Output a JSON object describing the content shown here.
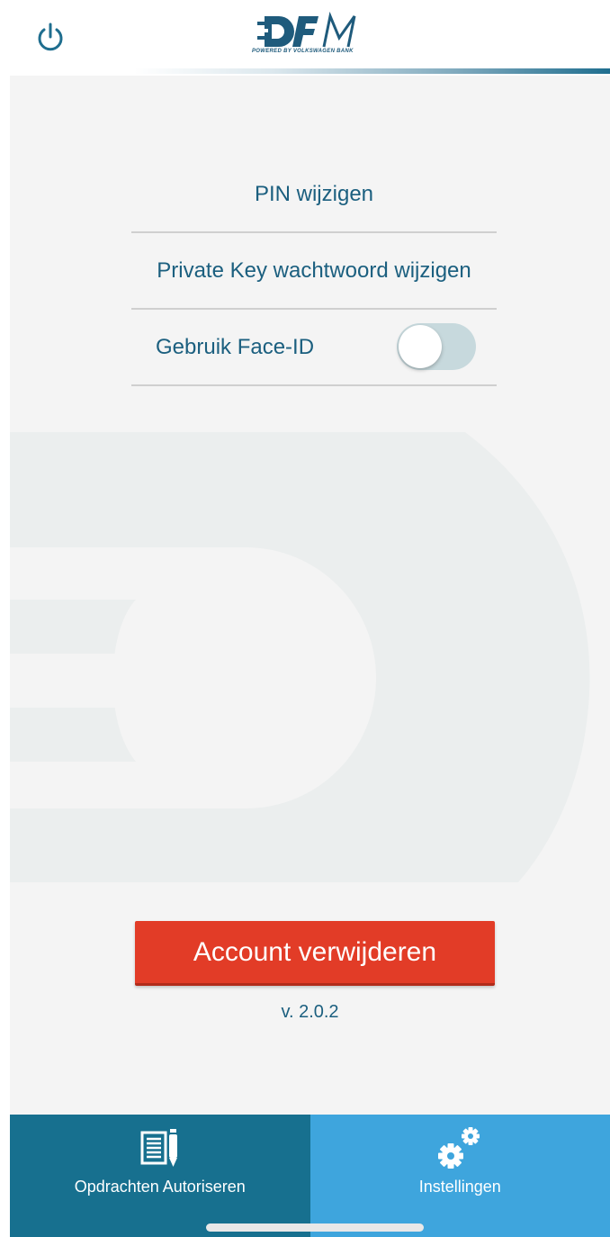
{
  "header": {
    "power_icon": "power-icon",
    "logo_text": "DFM",
    "logo_tagline": "POWERED BY VOLKSWAGEN BANK"
  },
  "settings": {
    "change_pin": "PIN wijzigen",
    "change_private_key_password": "Private Key wachtwoord wijzigen",
    "face_id": {
      "label": "Gebruik Face-ID",
      "enabled": false
    }
  },
  "actions": {
    "delete_account": "Account verwijderen"
  },
  "version": "v. 2.0.2",
  "tabbar": {
    "tabs": [
      {
        "label": "Opdrachten Autoriseren",
        "icon": "document-pen-icon",
        "active": false
      },
      {
        "label": "Instellingen",
        "icon": "gears-icon",
        "active": true
      }
    ]
  },
  "colors": {
    "primary_text": "#1b5f7f",
    "brand_dark": "#1f5b7c",
    "danger": "#e23c27",
    "tab_inactive": "#17708f",
    "tab_active": "#3ea5dd",
    "toggle_off": "#c7d9dd"
  }
}
